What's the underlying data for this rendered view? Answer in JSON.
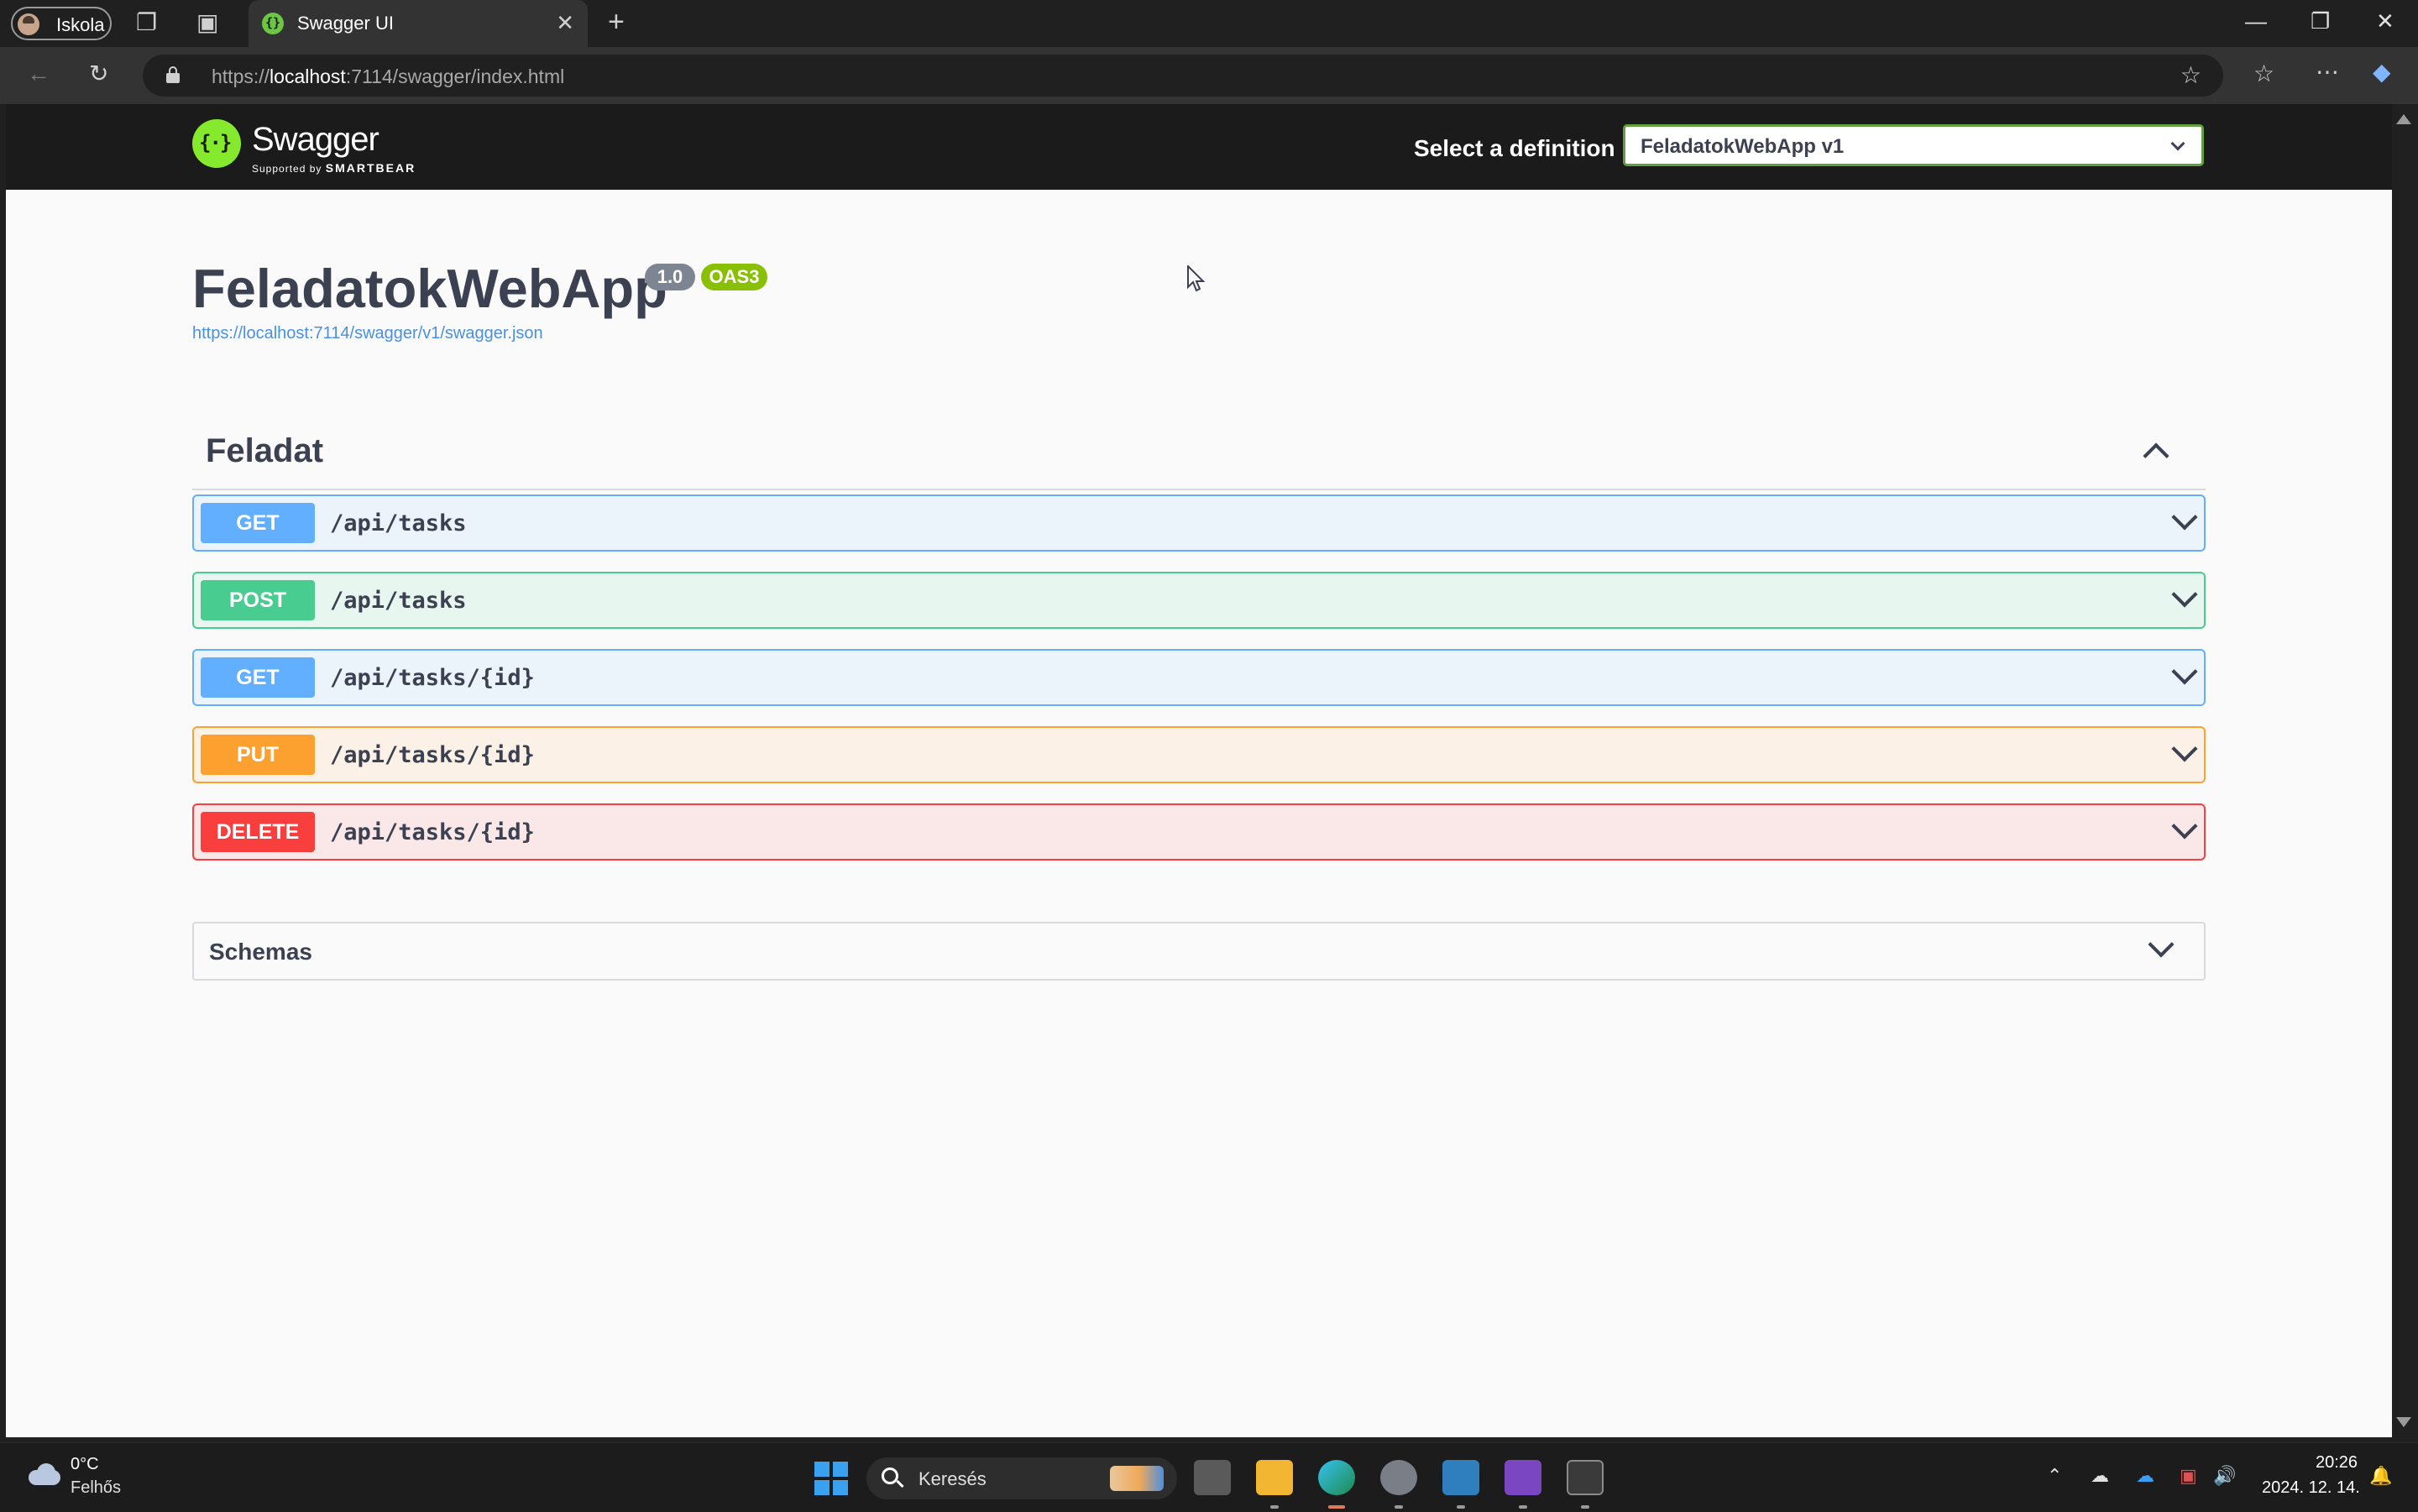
{
  "browser": {
    "profile_label": "Iskola",
    "tab_title": "Swagger UI",
    "url_scheme": "https://",
    "url_host": "localhost",
    "url_rest": ":7114/swagger/index.html"
  },
  "swagger": {
    "logo_name": "Swagger",
    "logo_sub_prefix": "Supported by",
    "logo_sub_brand": "SMARTBEAR",
    "definition_label": "Select a definition",
    "definition_value": "FeladatokWebApp v1",
    "title": "FeladatokWebApp",
    "version": "1.0",
    "oas_badge": "OAS3",
    "spec_url": "https://localhost:7114/swagger/v1/swagger.json",
    "tag": "Feladat",
    "operations": [
      {
        "method": "GET",
        "path": "/api/tasks"
      },
      {
        "method": "POST",
        "path": "/api/tasks"
      },
      {
        "method": "GET",
        "path": "/api/tasks/{id}"
      },
      {
        "method": "PUT",
        "path": "/api/tasks/{id}"
      },
      {
        "method": "DELETE",
        "path": "/api/tasks/{id}"
      }
    ],
    "schemas_label": "Schemas"
  },
  "taskbar": {
    "weather_temp": "0°C",
    "weather_desc": "Felhős",
    "search_label": "Keresés",
    "clock_time": "20:26",
    "clock_date": "2024. 12. 14."
  },
  "colors": {
    "get": "#61affe",
    "post": "#49cc90",
    "put": "#fca130",
    "delete": "#f93e3e",
    "swagger_green": "#85ea2d"
  }
}
